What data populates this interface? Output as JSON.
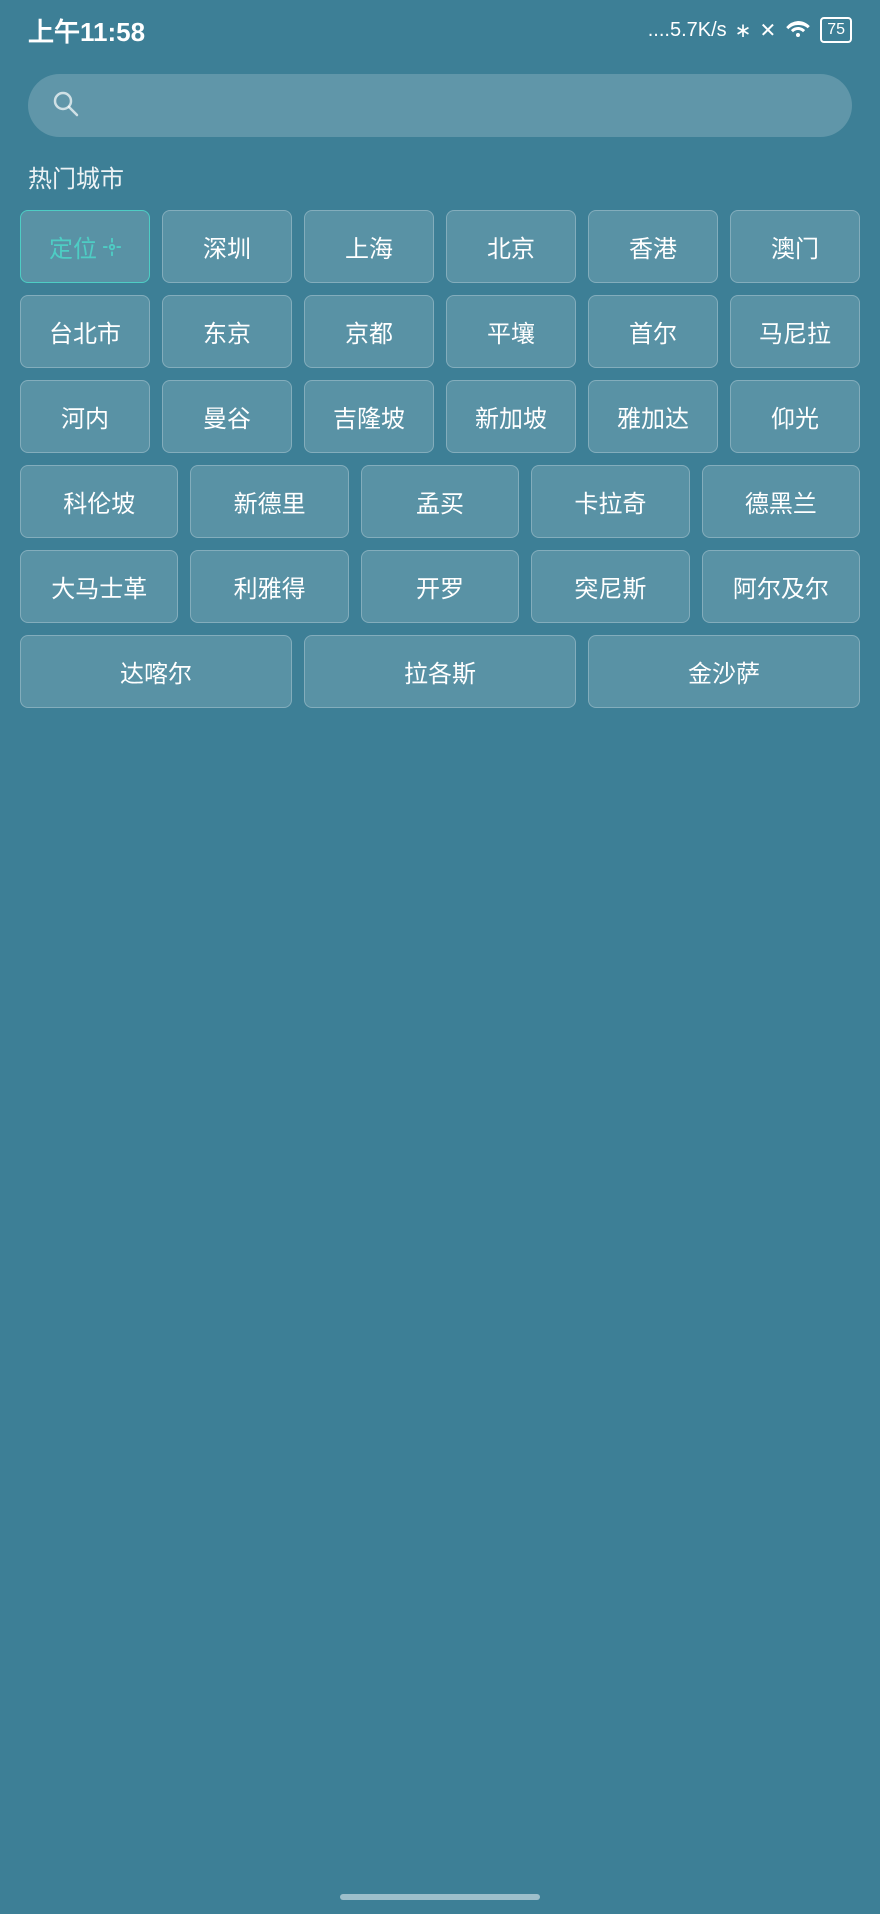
{
  "statusBar": {
    "time": "上午11:58",
    "signal": "....5.7K/s",
    "bluetooth": "bluetooth",
    "sim": "✕",
    "wifi": "wifi",
    "battery": "75"
  },
  "search": {
    "placeholder": ""
  },
  "sectionTitle": "热门城市",
  "cities": {
    "rows": [
      [
        {
          "label": "定位",
          "type": "locate"
        },
        {
          "label": "深圳",
          "type": "normal"
        },
        {
          "label": "上海",
          "type": "normal"
        },
        {
          "label": "北京",
          "type": "normal"
        },
        {
          "label": "香港",
          "type": "normal"
        },
        {
          "label": "澳门",
          "type": "normal"
        }
      ],
      [
        {
          "label": "台北市",
          "type": "normal"
        },
        {
          "label": "东京",
          "type": "normal"
        },
        {
          "label": "京都",
          "type": "normal"
        },
        {
          "label": "平壤",
          "type": "normal"
        },
        {
          "label": "首尔",
          "type": "normal"
        },
        {
          "label": "马尼拉",
          "type": "normal"
        }
      ],
      [
        {
          "label": "河内",
          "type": "normal"
        },
        {
          "label": "曼谷",
          "type": "normal"
        },
        {
          "label": "吉隆坡",
          "type": "normal"
        },
        {
          "label": "新加坡",
          "type": "normal"
        },
        {
          "label": "雅加达",
          "type": "normal"
        },
        {
          "label": "仰光",
          "type": "normal"
        }
      ],
      [
        {
          "label": "科伦坡",
          "type": "normal"
        },
        {
          "label": "新德里",
          "type": "normal"
        },
        {
          "label": "孟买",
          "type": "normal"
        },
        {
          "label": "卡拉奇",
          "type": "normal"
        },
        {
          "label": "德黑兰",
          "type": "normal"
        }
      ],
      [
        {
          "label": "大马士革",
          "type": "normal"
        },
        {
          "label": "利雅得",
          "type": "normal"
        },
        {
          "label": "开罗",
          "type": "normal"
        },
        {
          "label": "突尼斯",
          "type": "normal"
        },
        {
          "label": "阿尔及尔",
          "type": "normal"
        }
      ],
      [
        {
          "label": "达喀尔",
          "type": "normal"
        },
        {
          "label": "拉各斯",
          "type": "normal"
        },
        {
          "label": "金沙萨",
          "type": "normal"
        }
      ]
    ]
  }
}
